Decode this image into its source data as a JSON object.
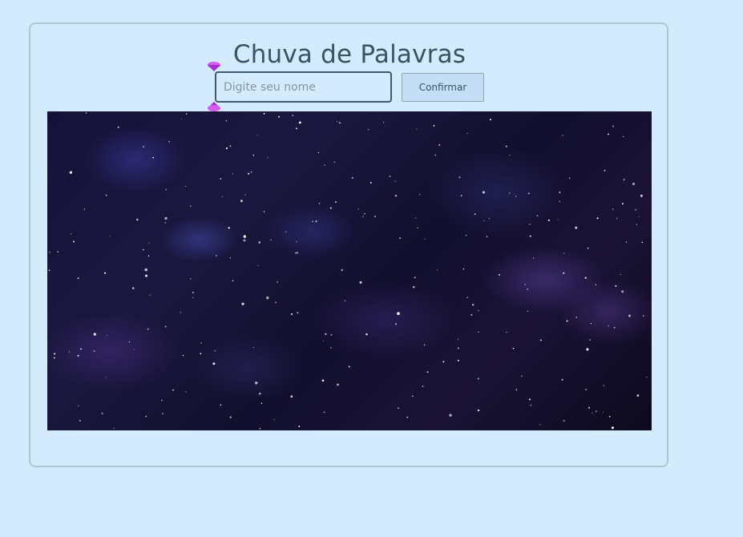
{
  "header": {
    "title": "Chuva de Palavras"
  },
  "name_input": {
    "placeholder": "Digite seu nome",
    "value": ""
  },
  "confirm_button": {
    "label": "Confirmar"
  },
  "colors": {
    "background": "#d3ebfd",
    "card_border": "#a9c9d4",
    "title_text": "#385467",
    "gem": "#c43ce8",
    "sky_dark": "#0d0a1e",
    "nebula": "#3c3ca0"
  },
  "icons": {
    "gem_top": "purple-gem-icon",
    "gem_bottom": "purple-gem-icon"
  }
}
